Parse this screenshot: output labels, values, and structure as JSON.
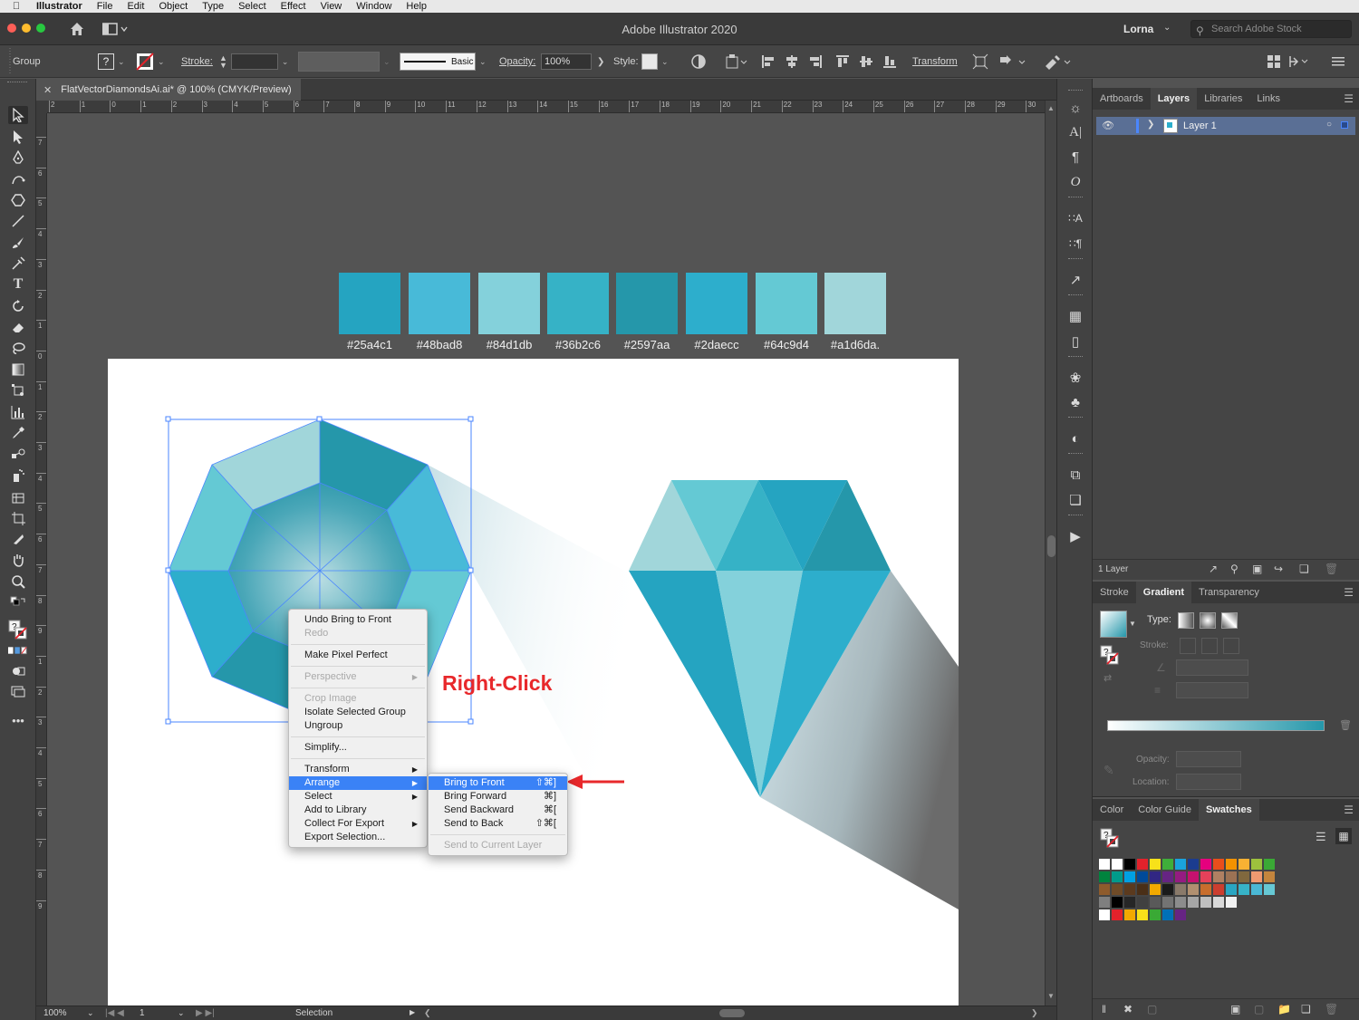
{
  "menubar": {
    "app": "Illustrator",
    "items": [
      "File",
      "Edit",
      "Object",
      "Type",
      "Select",
      "Effect",
      "View",
      "Window",
      "Help"
    ]
  },
  "titlebar": {
    "title": "Adobe Illustrator 2020",
    "user": "Lorna",
    "search_placeholder": "Search Adobe Stock"
  },
  "controlbar": {
    "selection_label": "Group",
    "stroke_label": "Stroke:",
    "brush_label": "Basic",
    "opacity_label": "Opacity:",
    "opacity_value": "100%",
    "style_label": "Style:",
    "transform_label": "Transform"
  },
  "document": {
    "tab_title": "FlatVectorDiamondsAi.ai* @ 100% (CMYK/Preview)"
  },
  "hruler_ticks": [
    "2",
    "1",
    "0",
    "1",
    "2",
    "3",
    "4",
    "5",
    "6",
    "7",
    "8",
    "9",
    "10",
    "11",
    "12",
    "13",
    "14",
    "15",
    "16",
    "17",
    "18",
    "19",
    "20",
    "21",
    "22",
    "23",
    "24",
    "25",
    "26",
    "27",
    "28",
    "29",
    "30"
  ],
  "vruler_ticks": [
    "7",
    "6",
    "5",
    "4",
    "3",
    "2",
    "1",
    "0",
    "1",
    "2",
    "3",
    "4",
    "5",
    "6",
    "7",
    "8",
    "9",
    "1",
    "2",
    "3",
    "4",
    "5",
    "6",
    "7",
    "8",
    "9"
  ],
  "palette": [
    {
      "hex": "#25a4c1",
      "label": "#25a4c1"
    },
    {
      "hex": "#48bad8",
      "label": "#48bad8"
    },
    {
      "hex": "#84d1db",
      "label": "#84d1db"
    },
    {
      "hex": "#36b2c6",
      "label": "#36b2c6"
    },
    {
      "hex": "#2597aa",
      "label": "#2597aa"
    },
    {
      "hex": "#2daecc",
      "label": "#2daecc"
    },
    {
      "hex": "#64c9d4",
      "label": "#64c9d4"
    },
    {
      "hex": "#a1d6da",
      "label": "#a1d6da."
    }
  ],
  "annotation": "Right-Click",
  "context_menu": {
    "items": {
      "undo": "Undo Bring to Front",
      "redo": "Redo",
      "pixel": "Make Pixel Perfect",
      "perspective": "Perspective",
      "crop": "Crop Image",
      "isolate": "Isolate Selected Group",
      "ungroup": "Ungroup",
      "simplify": "Simplify...",
      "transform": "Transform",
      "arrange": "Arrange",
      "select": "Select",
      "library": "Add to Library",
      "collect": "Collect For Export",
      "export": "Export Selection..."
    }
  },
  "arrange_submenu": {
    "bring_front": {
      "label": "Bring to Front",
      "shortcut": "⇧⌘]"
    },
    "bring_forward": {
      "label": "Bring Forward",
      "shortcut": "⌘]"
    },
    "send_backward": {
      "label": "Send Backward",
      "shortcut": "⌘["
    },
    "send_back": {
      "label": "Send to Back",
      "shortcut": "⇧⌘["
    },
    "send_layer": {
      "label": "Send to Current Layer"
    }
  },
  "statusbar": {
    "zoom": "100%",
    "artboard": "1",
    "tool": "Selection"
  },
  "layers_panel": {
    "tabs": [
      "Artboards",
      "Layers",
      "Libraries",
      "Links"
    ],
    "active": "Layers",
    "layer_name": "Layer 1",
    "count": "1 Layer"
  },
  "gradient_panel": {
    "tabs": [
      "Stroke",
      "Gradient",
      "Transparency"
    ],
    "active": "Gradient",
    "type_label": "Type:",
    "stroke_label": "Stroke:",
    "opacity_label": "Opacity:",
    "location_label": "Location:"
  },
  "swatches_panel": {
    "tabs": [
      "Color",
      "Color Guide",
      "Swatches"
    ],
    "active": "Swatches",
    "rows": [
      [
        "#ffffff",
        "#ffffff",
        "#000000",
        "#e3222b",
        "#f7e11a",
        "#3fae3a",
        "#1aa3dd",
        "#1b3c8f",
        "#e6007e",
        "#e94e1b",
        "#f39200",
        "#f8b133",
        "#9dc13d",
        "#3aa935"
      ],
      [
        "#00833e",
        "#009a8b",
        "#00a0e3",
        "#004a99",
        "#312783",
        "#662483",
        "#951b81",
        "#c5126f",
        "#e6415a",
        "#b08062",
        "#9c7254",
        "#80683e",
        "#f09970",
        "#c4853d"
      ],
      [
        "#8e5b2c",
        "#6f4b28",
        "#5b3a1e",
        "#4a2f17",
        "#f2a900",
        "#1a1a1a",
        "#8a7a6a",
        "#b19070",
        "#c86e2d",
        "#cc3e2f",
        "#2aa6c2",
        "#37b3c7",
        "#4ab8d5",
        "#66c8d4"
      ],
      [
        "#7f7f7f",
        "#000000",
        "#262626",
        "#404040",
        "#595959",
        "#737373",
        "#8c8c8c",
        "#a6a6a6",
        "#bfbfbf",
        "#d9d9d9",
        "#f2f2f2"
      ],
      [
        "#ffffff",
        "#e3222b",
        "#f2a900",
        "#f7e11a",
        "#3aa935",
        "#0070b8",
        "#662483"
      ]
    ]
  },
  "colors": {
    "accent": "#3a82f6",
    "annotation_red": "#e8282b"
  }
}
